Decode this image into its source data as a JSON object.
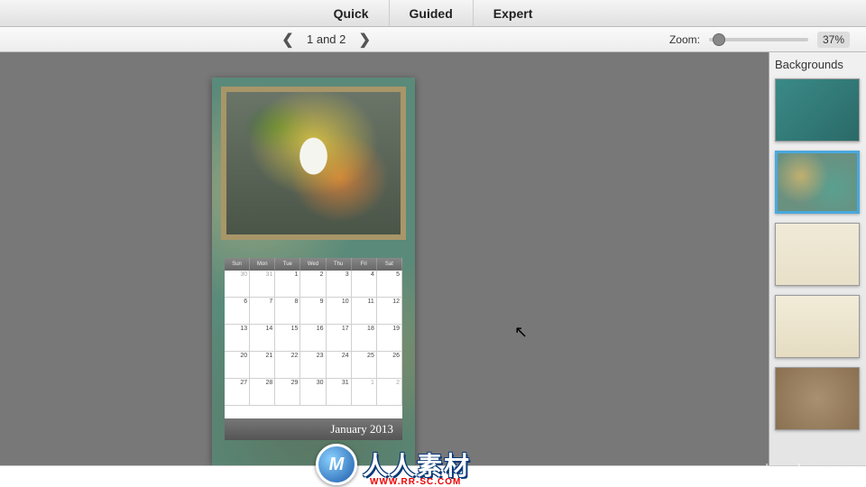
{
  "tabs": {
    "quick": "Quick",
    "guided": "Guided",
    "expert": "Expert"
  },
  "nav": {
    "page_label": "1 and 2"
  },
  "zoom": {
    "label": "Zoom:",
    "value": "37%"
  },
  "sidebar": {
    "title": "Backgrounds"
  },
  "calendar": {
    "month_year": "January  2013",
    "dow": [
      "Sun",
      "Mon",
      "Tue",
      "Wed",
      "Thu",
      "Fri",
      "Sat"
    ],
    "cells": [
      {
        "n": "30",
        "dim": true
      },
      {
        "n": "31",
        "dim": true
      },
      {
        "n": "1"
      },
      {
        "n": "2"
      },
      {
        "n": "3"
      },
      {
        "n": "4"
      },
      {
        "n": "5"
      },
      {
        "n": "6"
      },
      {
        "n": "7"
      },
      {
        "n": "8"
      },
      {
        "n": "9"
      },
      {
        "n": "10"
      },
      {
        "n": "11"
      },
      {
        "n": "12"
      },
      {
        "n": "13"
      },
      {
        "n": "14"
      },
      {
        "n": "15"
      },
      {
        "n": "16"
      },
      {
        "n": "17"
      },
      {
        "n": "18"
      },
      {
        "n": "19"
      },
      {
        "n": "20"
      },
      {
        "n": "21"
      },
      {
        "n": "22"
      },
      {
        "n": "23"
      },
      {
        "n": "24"
      },
      {
        "n": "25"
      },
      {
        "n": "26"
      },
      {
        "n": "27"
      },
      {
        "n": "28"
      },
      {
        "n": "29"
      },
      {
        "n": "30"
      },
      {
        "n": "31"
      },
      {
        "n": "1",
        "dim": true
      },
      {
        "n": "2",
        "dim": true
      }
    ]
  },
  "watermark": {
    "cn": "人人素材",
    "url": "WWW.RR-SC.COM"
  },
  "lynda": "lynda.com"
}
